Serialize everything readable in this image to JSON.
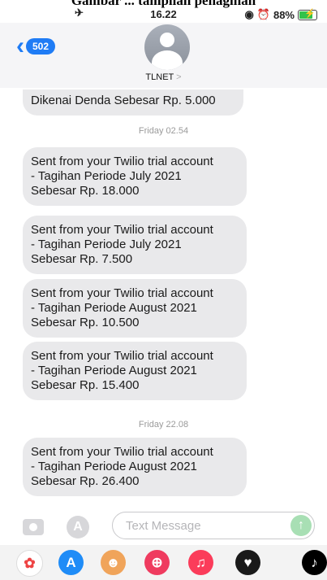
{
  "caption": "Gambar ... tampilan penagihan",
  "status_bar": {
    "time": "16.22",
    "battery_percent": "88%",
    "battery_level": 0.88,
    "airplane_icon": "airplane-icon",
    "icons": [
      "orientation-lock-icon",
      "alarm-icon"
    ]
  },
  "header": {
    "back_badge": "502",
    "contact_name": "TLNET",
    "contact_arrow": ">"
  },
  "messages": [
    {
      "type": "received",
      "text": "Dikenai Denda Sebesar Rp. 5.000"
    },
    {
      "type": "time",
      "text": "Friday 02.54"
    },
    {
      "type": "received",
      "text": "Sent from your Twilio trial account\n- Tagihan Periode July 2021\nSebesar Rp. 18.000"
    },
    {
      "type": "received",
      "text": "Sent from your Twilio trial account\n- Tagihan Periode July 2021\nSebesar Rp. 7.500"
    },
    {
      "type": "received",
      "text": "Sent from your Twilio trial account\n- Tagihan Periode August 2021\nSebesar Rp. 10.500"
    },
    {
      "type": "received",
      "text": "Sent from your Twilio trial account\n- Tagihan Periode August 2021\nSebesar Rp. 15.400"
    },
    {
      "type": "time",
      "text": "Friday 22.08"
    },
    {
      "type": "received",
      "text": "Sent from your Twilio trial account\n- Tagihan Periode August 2021\nSebesar Rp. 26.400"
    }
  ],
  "input": {
    "placeholder": "Text Message",
    "value": "",
    "send_symbol": "↑",
    "apps_symbol": "A"
  },
  "app_drawer": [
    {
      "name": "photos-app-icon",
      "color": "#ffffff",
      "glyph": "✿"
    },
    {
      "name": "app-store-icon",
      "color": "#1f8cf7",
      "glyph": "A"
    },
    {
      "name": "memoji-app-icon",
      "color": "#f0a45a",
      "glyph": "☻"
    },
    {
      "name": "images-search-app-icon",
      "color": "#ef3b5f",
      "glyph": "⊕"
    },
    {
      "name": "music-app-icon",
      "color": "#fb3c5a",
      "glyph": "♫"
    },
    {
      "name": "digital-touch-app-icon",
      "color": "#1a1a1a",
      "glyph": "♥"
    },
    {
      "name": "tiktok-app-icon",
      "color": "#000000",
      "glyph": "♪"
    }
  ]
}
